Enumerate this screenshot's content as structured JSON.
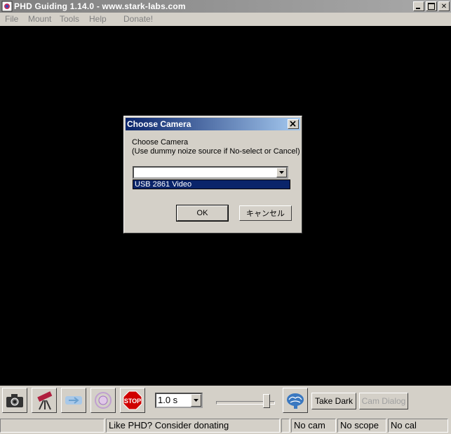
{
  "window": {
    "title": "PHD Guiding 1.14.0  -  www.stark-labs.com"
  },
  "menu": {
    "items": [
      "File",
      "Mount",
      "Tools",
      "Help",
      "Donate!"
    ]
  },
  "dialog": {
    "title": "Choose Camera",
    "line1": "Choose Camera",
    "line2": "(Use dummy noize source if No-select or Cancel)",
    "combo_value": "",
    "list_selected": "USB 2861 Video",
    "ok_label": "OK",
    "cancel_label": "キャンセル"
  },
  "toolbar": {
    "exposure_value": "1.0 s",
    "gain_slider_fraction": 0.9,
    "take_dark_label": "Take Dark",
    "cam_dialog_label": "Cam Dialog",
    "icons": [
      "camera-icon",
      "telescope-icon",
      "loop-icon",
      "guide-icon",
      "stop-icon",
      "brain-icon"
    ]
  },
  "status": {
    "message": "Like PHD? Consider donating",
    "cam": "No cam",
    "scope": "No scope",
    "cal": "No cal"
  },
  "colors": {
    "title_active": "#0a246a",
    "title_inactive": "#808080",
    "face": "#d4d0c8",
    "viewport": "#000000"
  }
}
